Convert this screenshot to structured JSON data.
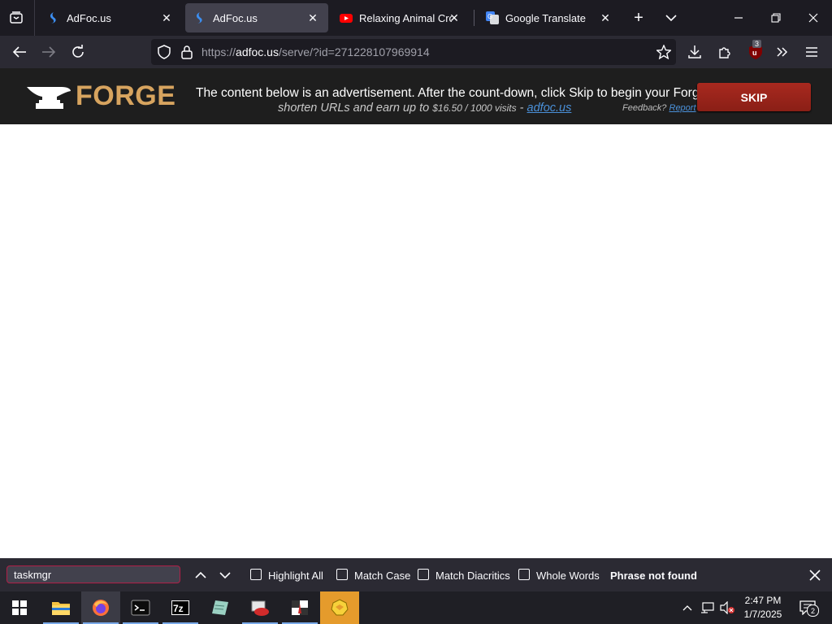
{
  "tabs": [
    {
      "title": "AdFoc.us",
      "active": false
    },
    {
      "title": "AdFoc.us",
      "active": true
    },
    {
      "title": "Relaxing Animal Crossi",
      "active": false
    },
    {
      "title": "Google Translate",
      "active": false
    }
  ],
  "urlbar": {
    "url_prefix": "https://",
    "url_domain": "adfoc.us",
    "url_path": "/serve/?id=271228107969914"
  },
  "extension_badge": "3",
  "ad": {
    "logo_text": "FORGE",
    "line1": "The content below is an advertisement. After the count-down, click Skip to begin your Forge download.",
    "line2_prefix": "shorten URLs and earn up to ",
    "line2_rate": "$16.50 / 1000 visits",
    "line2_dash": " - ",
    "line2_link": "adfoc.us",
    "feedback_label": "Feedback?",
    "feedback_link": "Report",
    "skip_label": "SKIP"
  },
  "findbar": {
    "query": "taskmgr",
    "options": [
      {
        "label": "Highlight All",
        "checked": false
      },
      {
        "label": "Match Case",
        "checked": false
      },
      {
        "label": "Match Diacritics",
        "checked": false
      },
      {
        "label": "Whole Words",
        "checked": false
      }
    ],
    "status": "Phrase not found"
  },
  "taskbar": {
    "time": "2:47 PM",
    "date": "1/7/2025",
    "notification_count": "2",
    "apps": [
      "file-explorer",
      "firefox",
      "terminal",
      "7-zip",
      "notepad",
      "app-red",
      "app-chess",
      "app-yellow"
    ]
  },
  "colors": {
    "tabstrip": "#1c1b22",
    "toolbar": "#2b2a33",
    "active_tab": "#42414d",
    "forge_gold": "#d7a45f",
    "skip_red": "#a8291f",
    "find_border": "#b11f48"
  }
}
